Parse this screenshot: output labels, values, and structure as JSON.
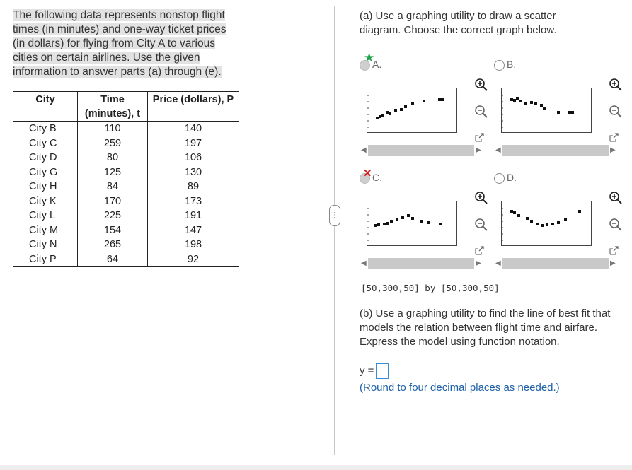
{
  "intro_text": "The following data represents nonstop flight times (in minutes) and one-way ticket prices (in dollars) for flying from City A to various cities on certain airlines. Use the given information to answer parts (a) through (e).",
  "table": {
    "headers": [
      "City",
      "Time (minutes), t",
      "Price (dollars), P"
    ],
    "rows": [
      [
        "City B",
        "110",
        "140"
      ],
      [
        "City C",
        "259",
        "197"
      ],
      [
        "City D",
        "80",
        "106"
      ],
      [
        "City G",
        "125",
        "130"
      ],
      [
        "City H",
        "84",
        "89"
      ],
      [
        "City K",
        "170",
        "173"
      ],
      [
        "City L",
        "225",
        "191"
      ],
      [
        "City M",
        "154",
        "147"
      ],
      [
        "City N",
        "265",
        "198"
      ],
      [
        "City P",
        "64",
        "92"
      ]
    ]
  },
  "question_a": "(a) Use a graphing utility to draw a scatter diagram. Choose the correct graph below.",
  "options": [
    {
      "label": "A.",
      "state": "correct",
      "mark": "★"
    },
    {
      "label": "B.",
      "state": "none",
      "mark": ""
    },
    {
      "label": "C.",
      "state": "incorrect",
      "mark": "✕"
    },
    {
      "label": "D.",
      "state": "none",
      "mark": ""
    }
  ],
  "window_text": "[50,300,50] by [50,300,50]",
  "question_b": "(b) Use a graphing utility to find the line of best fit that models the relation between flight time and airfare. Express the model using function notation.",
  "answer_prefix": "y =",
  "hint": "(Round to four decimal places as needed.)",
  "handle_text": "⋮",
  "icons": [
    "star-icon",
    "cross-icon",
    "zoom-in-icon",
    "zoom-out-icon",
    "expand-icon"
  ]
}
